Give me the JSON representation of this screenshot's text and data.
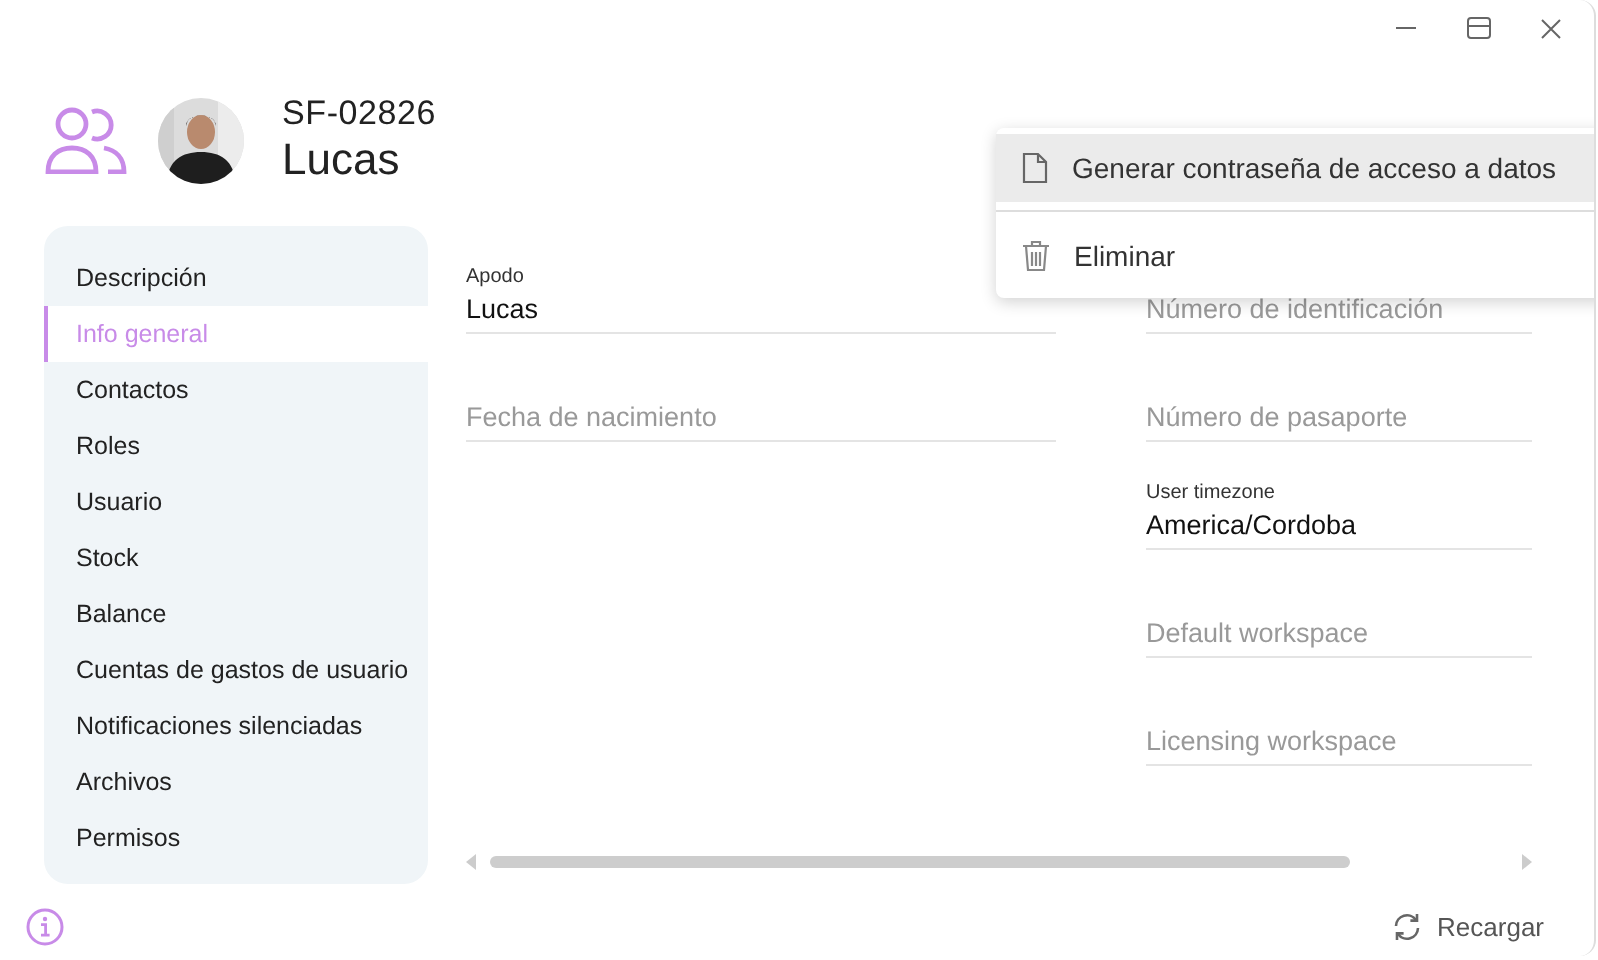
{
  "header": {
    "code": "SF-02826",
    "name": "Lucas"
  },
  "sidebar": {
    "items": [
      {
        "label": "Descripción",
        "selected": false
      },
      {
        "label": "Info general",
        "selected": true
      },
      {
        "label": "Contactos",
        "selected": false
      },
      {
        "label": "Roles",
        "selected": false
      },
      {
        "label": "Usuario",
        "selected": false
      },
      {
        "label": "Stock",
        "selected": false
      },
      {
        "label": "Balance",
        "selected": false
      },
      {
        "label": "Cuentas de gastos de usuario",
        "selected": false
      },
      {
        "label": "Notificaciones silenciadas",
        "selected": false
      },
      {
        "label": "Archivos",
        "selected": false
      },
      {
        "label": "Permisos",
        "selected": false
      }
    ]
  },
  "form": {
    "left": [
      {
        "label": "Apodo",
        "value": "Lucas"
      },
      {
        "placeholder": "Fecha de nacimiento"
      }
    ],
    "right": [
      {
        "placeholder": "Número de identificación"
      },
      {
        "placeholder": "Número de pasaporte"
      },
      {
        "label": "User timezone",
        "value": "America/Cordoba"
      },
      {
        "placeholder": "Default workspace"
      },
      {
        "placeholder": "Licensing workspace"
      }
    ]
  },
  "context_menu": {
    "items": [
      {
        "kind": "document",
        "label": "Generar contraseña de acceso a datos",
        "selected": true
      },
      {
        "kind": "trash",
        "label": "Eliminar",
        "selected": false
      }
    ]
  },
  "footer": {
    "reload": "Recargar"
  }
}
